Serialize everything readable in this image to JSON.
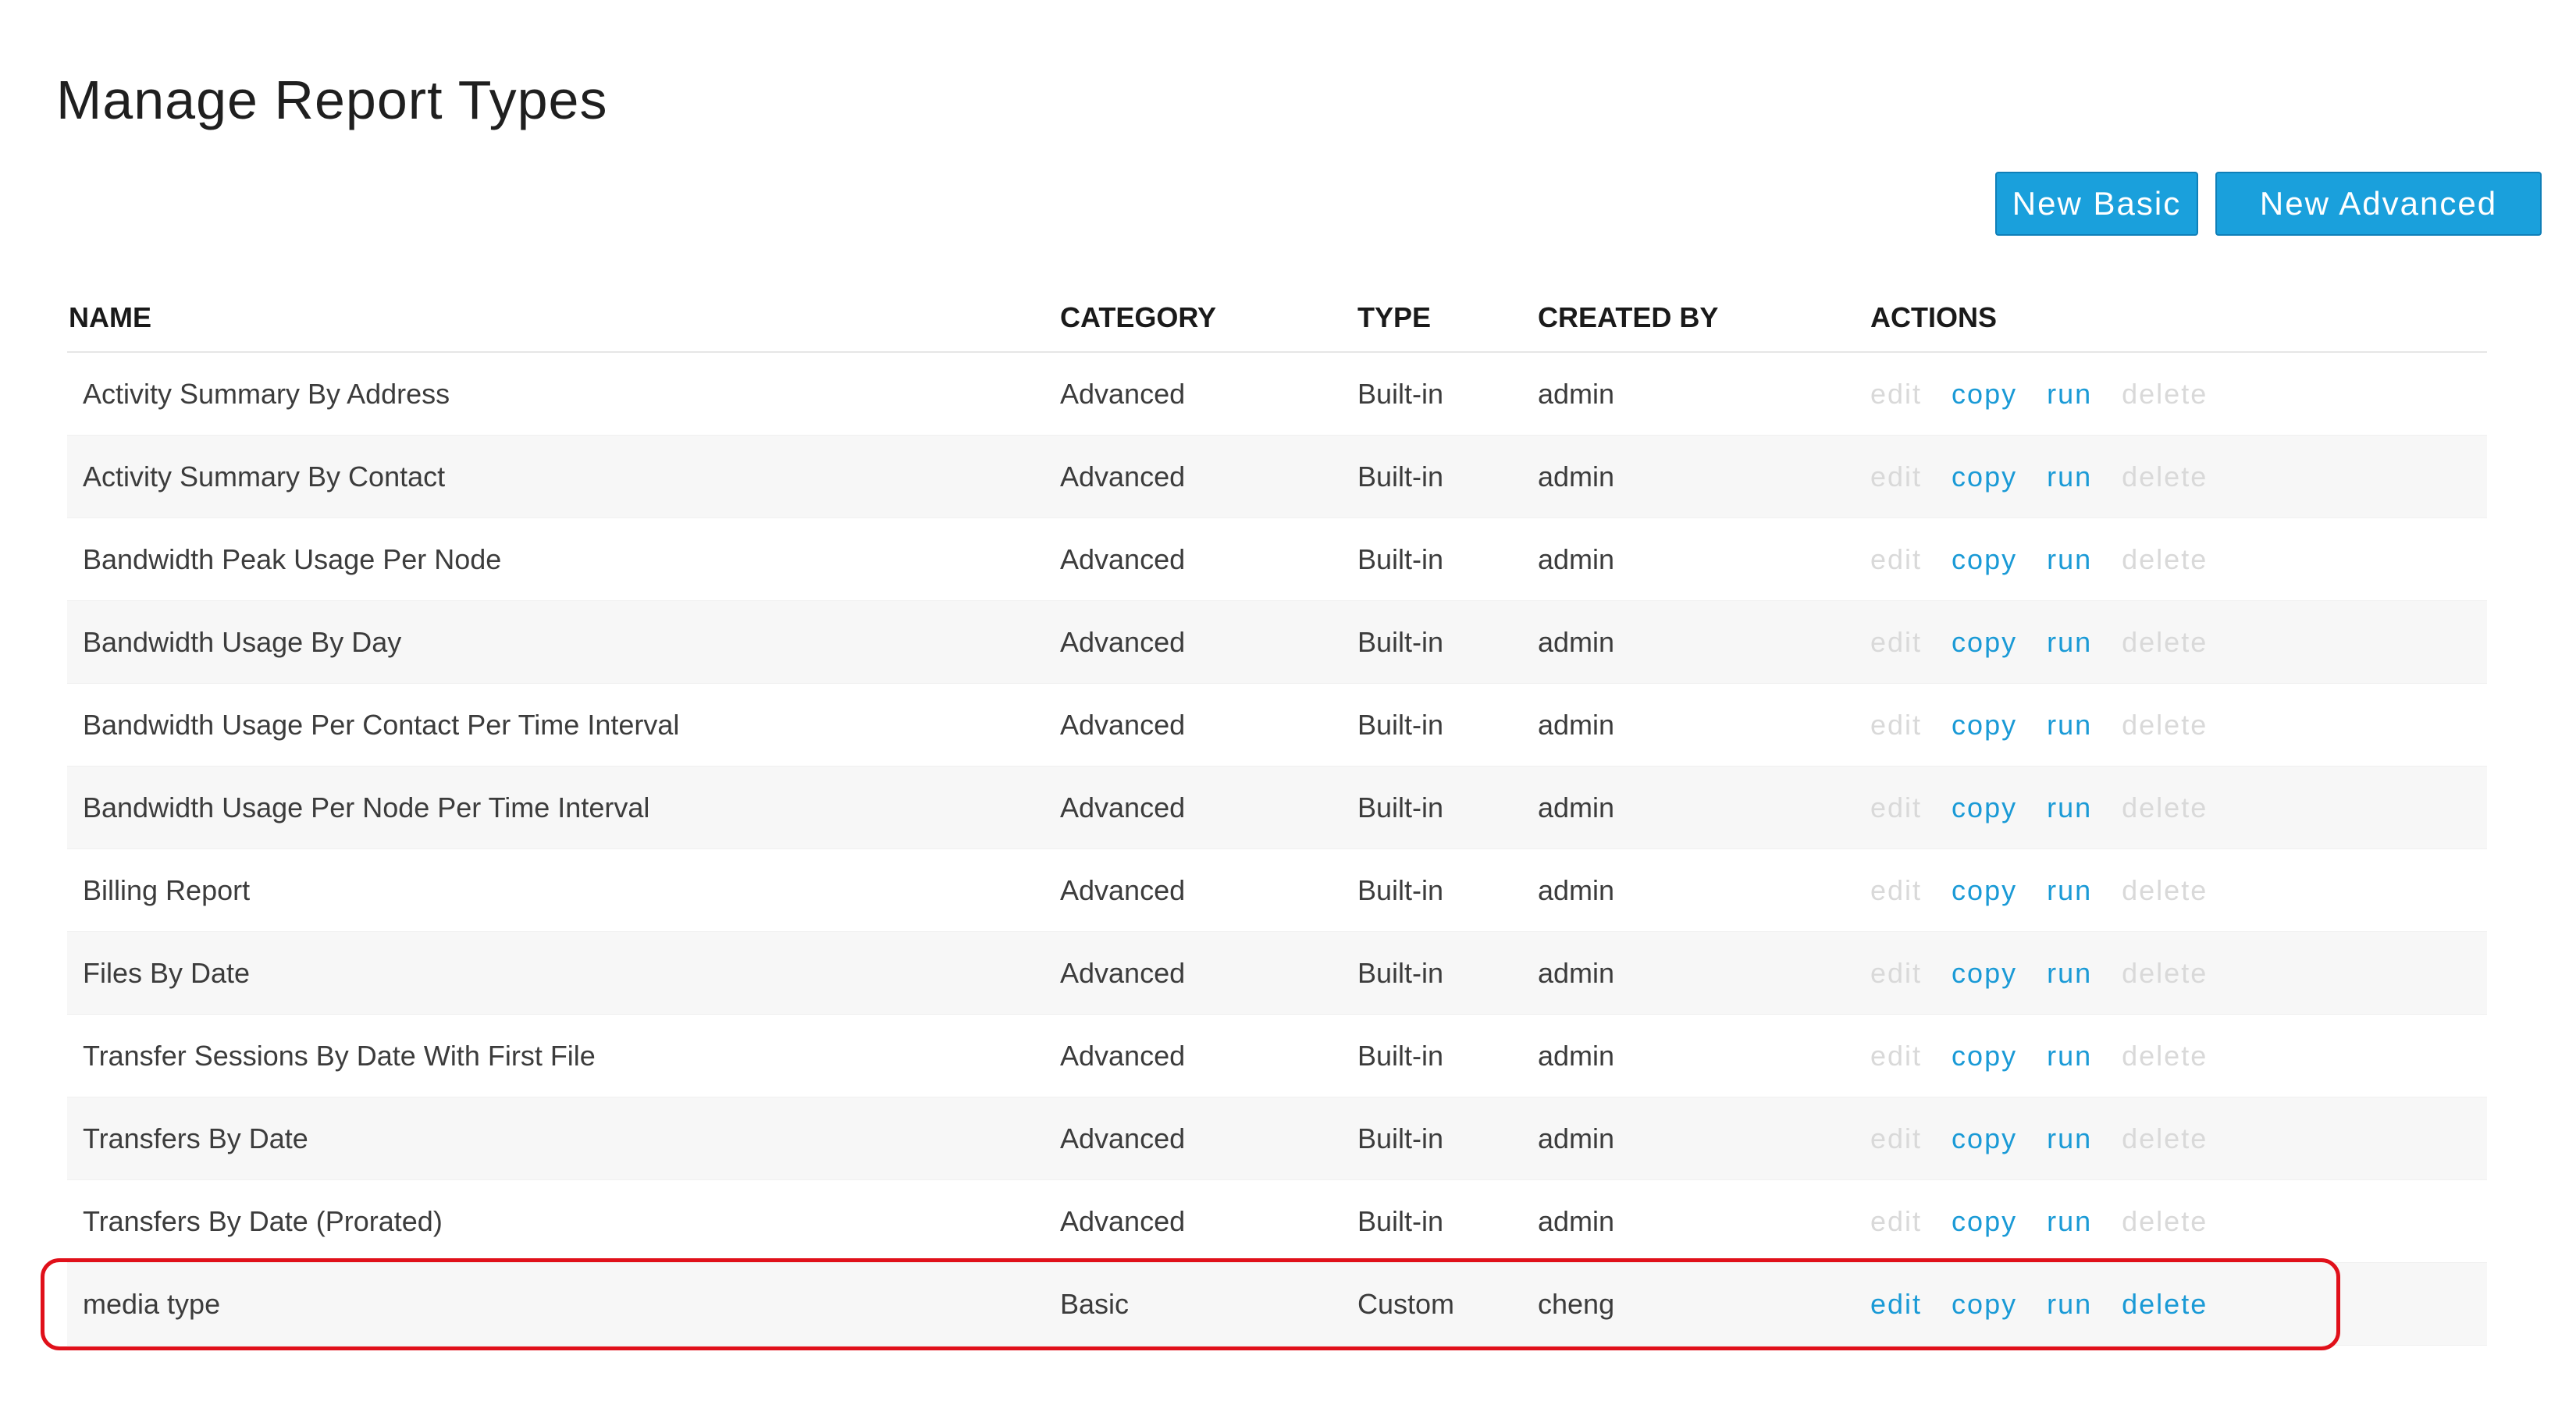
{
  "page": {
    "title": "Manage Report Types"
  },
  "toolbar": {
    "new_basic_label": "New Basic",
    "new_advanced_label": "New Advanced"
  },
  "table": {
    "headers": {
      "name": "NAME",
      "category": "CATEGORY",
      "type": "TYPE",
      "created_by": "CREATED BY",
      "actions": "ACTIONS"
    },
    "rows": [
      {
        "name": "Activity Summary By Address",
        "category": "Advanced",
        "type": "Built-in",
        "created_by": "admin",
        "actions": {
          "edit": "edit",
          "copy": "copy",
          "run": "run",
          "delete": "delete"
        },
        "editable": false
      },
      {
        "name": "Activity Summary By Contact",
        "category": "Advanced",
        "type": "Built-in",
        "created_by": "admin",
        "actions": {
          "edit": "edit",
          "copy": "copy",
          "run": "run",
          "delete": "delete"
        },
        "editable": false
      },
      {
        "name": "Bandwidth Peak Usage Per Node",
        "category": "Advanced",
        "type": "Built-in",
        "created_by": "admin",
        "actions": {
          "edit": "edit",
          "copy": "copy",
          "run": "run",
          "delete": "delete"
        },
        "editable": false
      },
      {
        "name": "Bandwidth Usage By Day",
        "category": "Advanced",
        "type": "Built-in",
        "created_by": "admin",
        "actions": {
          "edit": "edit",
          "copy": "copy",
          "run": "run",
          "delete": "delete"
        },
        "editable": false
      },
      {
        "name": "Bandwidth Usage Per Contact Per Time Interval",
        "category": "Advanced",
        "type": "Built-in",
        "created_by": "admin",
        "actions": {
          "edit": "edit",
          "copy": "copy",
          "run": "run",
          "delete": "delete"
        },
        "editable": false
      },
      {
        "name": "Bandwidth Usage Per Node Per Time Interval",
        "category": "Advanced",
        "type": "Built-in",
        "created_by": "admin",
        "actions": {
          "edit": "edit",
          "copy": "copy",
          "run": "run",
          "delete": "delete"
        },
        "editable": false
      },
      {
        "name": "Billing Report",
        "category": "Advanced",
        "type": "Built-in",
        "created_by": "admin",
        "actions": {
          "edit": "edit",
          "copy": "copy",
          "run": "run",
          "delete": "delete"
        },
        "editable": false
      },
      {
        "name": "Files By Date",
        "category": "Advanced",
        "type": "Built-in",
        "created_by": "admin",
        "actions": {
          "edit": "edit",
          "copy": "copy",
          "run": "run",
          "delete": "delete"
        },
        "editable": false
      },
      {
        "name": "Transfer Sessions By Date With First File",
        "category": "Advanced",
        "type": "Built-in",
        "created_by": "admin",
        "actions": {
          "edit": "edit",
          "copy": "copy",
          "run": "run",
          "delete": "delete"
        },
        "editable": false
      },
      {
        "name": "Transfers By Date",
        "category": "Advanced",
        "type": "Built-in",
        "created_by": "admin",
        "actions": {
          "edit": "edit",
          "copy": "copy",
          "run": "run",
          "delete": "delete"
        },
        "editable": false
      },
      {
        "name": "Transfers By Date (Prorated)",
        "category": "Advanced",
        "type": "Built-in",
        "created_by": "admin",
        "actions": {
          "edit": "edit",
          "copy": "copy",
          "run": "run",
          "delete": "delete"
        },
        "editable": false
      },
      {
        "name": "media type",
        "category": "Basic",
        "type": "Custom",
        "created_by": "cheng",
        "actions": {
          "edit": "edit",
          "copy": "copy",
          "run": "run",
          "delete": "delete"
        },
        "editable": true
      }
    ]
  },
  "colors": {
    "accent": "#1aa0dc",
    "link": "#1a9ad6",
    "disabled_link": "#d9d9d9",
    "highlight": "#e0101a"
  }
}
